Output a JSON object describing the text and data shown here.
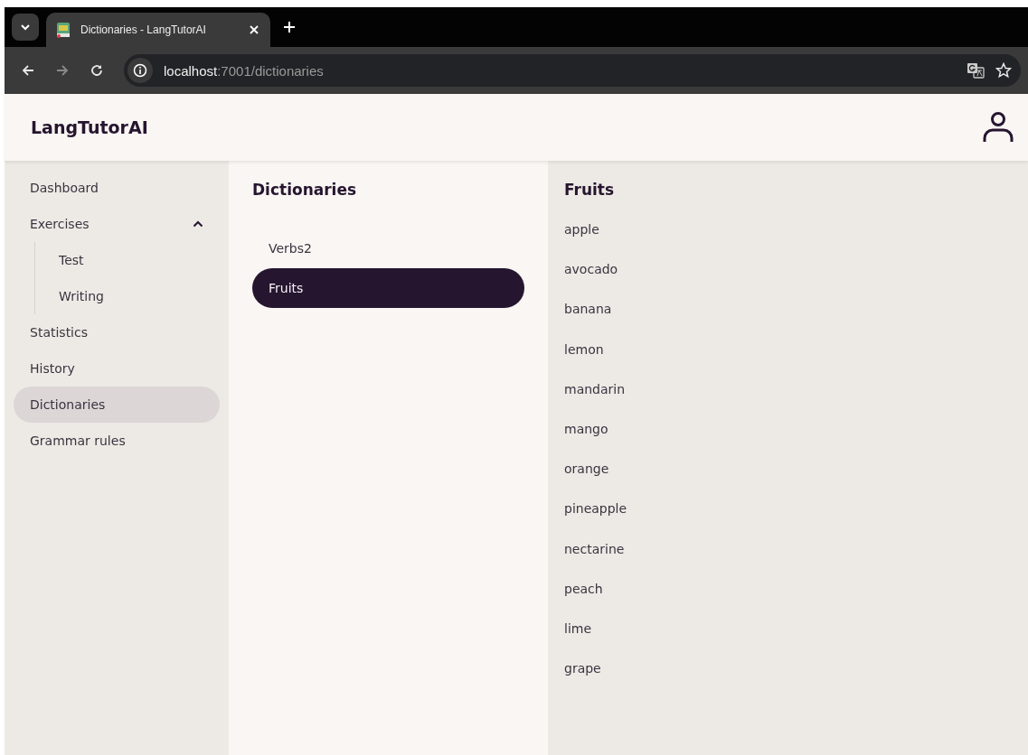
{
  "browser": {
    "tab_title": "Dictionaries - LangTutorAI",
    "url_host": "localhost",
    "url_path": ":7001/dictionaries"
  },
  "app": {
    "title": "LangTutorAI"
  },
  "sidebar": {
    "items": [
      {
        "label": "Dashboard",
        "selected": false
      },
      {
        "label": "Exercises",
        "selected": false,
        "expanded": true,
        "children": [
          {
            "label": "Test",
            "selected": false
          },
          {
            "label": "Writing",
            "selected": false
          }
        ]
      },
      {
        "label": "Statistics",
        "selected": false
      },
      {
        "label": "History",
        "selected": false
      },
      {
        "label": "Dictionaries",
        "selected": true
      },
      {
        "label": "Grammar rules",
        "selected": false
      }
    ]
  },
  "dictionaries": {
    "title": "Dictionaries",
    "items": [
      {
        "label": "Verbs2",
        "selected": false
      },
      {
        "label": "Fruits",
        "selected": true
      }
    ]
  },
  "words": {
    "title": "Fruits",
    "items": [
      "apple",
      "avocado",
      "banana",
      "lemon",
      "mandarin",
      "mango",
      "orange",
      "pineapple",
      "nectarine",
      "peach",
      "lime",
      "grape"
    ]
  }
}
